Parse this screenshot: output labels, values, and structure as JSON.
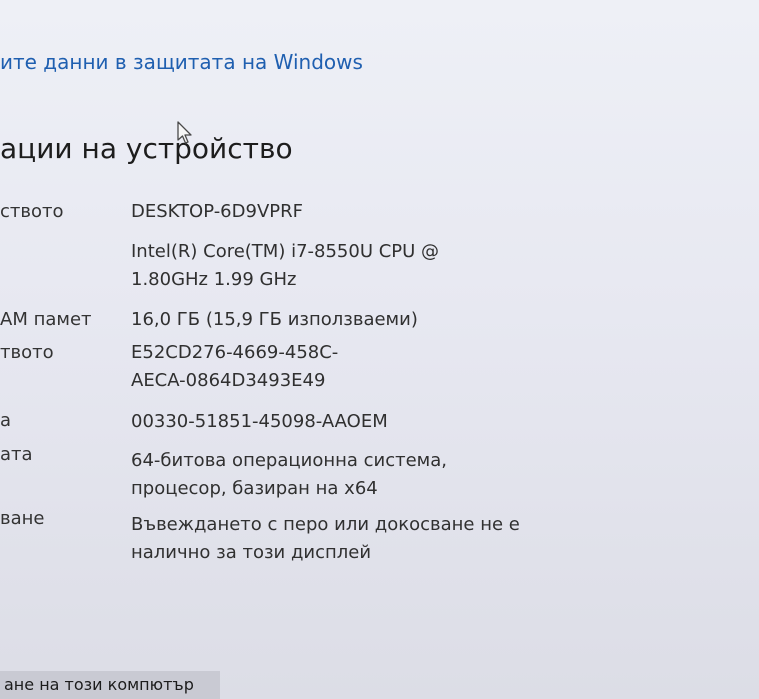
{
  "top_link": "ите данни в защитата на Windows",
  "section_title": "ации на устройство",
  "specs": [
    {
      "label": "ството",
      "value_lines": [
        "DESKTOP-6D9VPRF"
      ]
    },
    {
      "label": "",
      "value_lines": [
        "Intel(R) Core(TM) i7-8550U CPU @",
        "1.80GHz   1.99 GHz"
      ]
    },
    {
      "label": "АМ памет",
      "value_lines": [
        "16,0 ГБ (15,9 ГБ използваеми)"
      ]
    },
    {
      "label": "твото",
      "value_lines": [
        "E52CD276-4669-458C-",
        "AECA-0864D3493E49"
      ]
    },
    {
      "label": "а",
      "value_lines": [
        "00330-51851-45098-AAOEM"
      ]
    },
    {
      "label": "ата",
      "value_lines": [
        "64-битова операционна система,",
        "процесор, базиран на x64"
      ]
    },
    {
      "label": "ване",
      "value_lines": [
        "Въвеждането с перо или докосване не е",
        "налично за този дисплей"
      ]
    }
  ],
  "bottom_button": "ане на този компютър"
}
